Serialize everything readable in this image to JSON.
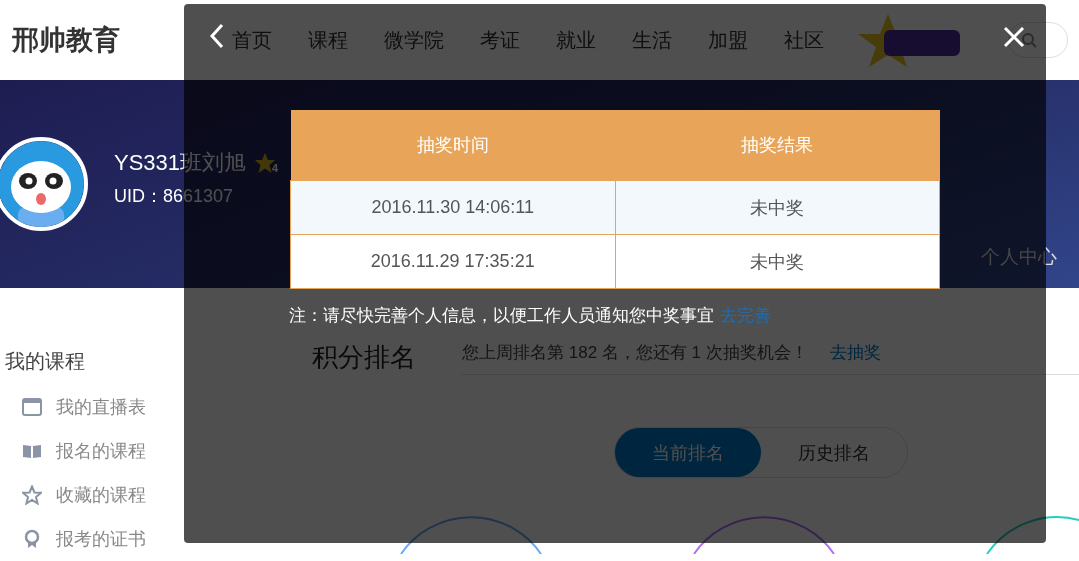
{
  "header": {
    "logo": "邢帅教育",
    "nav": [
      {
        "label": "首页"
      },
      {
        "label": "课程"
      },
      {
        "label": "微学院"
      },
      {
        "label": "考证"
      },
      {
        "label": "就业"
      },
      {
        "label": "生活"
      },
      {
        "label": "加盟"
      },
      {
        "label": "社区"
      }
    ]
  },
  "profile": {
    "name": "YS331班刘旭",
    "badge": "4",
    "uid": "UID：8661307",
    "center_link": "个人中心"
  },
  "sidebar": {
    "title": "我的课程",
    "items": [
      {
        "label": "我的直播表",
        "kind": "schedule"
      },
      {
        "label": "报名的课程",
        "kind": "book"
      },
      {
        "label": "收藏的课程",
        "kind": "star"
      },
      {
        "label": "报考的证书",
        "kind": "award"
      }
    ]
  },
  "ranking": {
    "title": "积分排名",
    "summary": "您上周排名第 182 名，您还有 1 次抽奖机会！",
    "link": "去抽奖",
    "tabs": [
      {
        "label": "当前排名",
        "selected": true
      },
      {
        "label": "历史排名",
        "selected": false
      }
    ]
  },
  "modal": {
    "table": {
      "columns": [
        "抽奖时间",
        "抽奖结果"
      ],
      "rows": [
        {
          "time": "2016.11.30 14:06:11",
          "result": "未中奖"
        },
        {
          "time": "2016.11.29 17:35:21",
          "result": "未中奖"
        }
      ]
    },
    "note": "注：请尽快完善个人信息，以便工作人员通知您中奖事宜",
    "note_link": "去完善"
  }
}
